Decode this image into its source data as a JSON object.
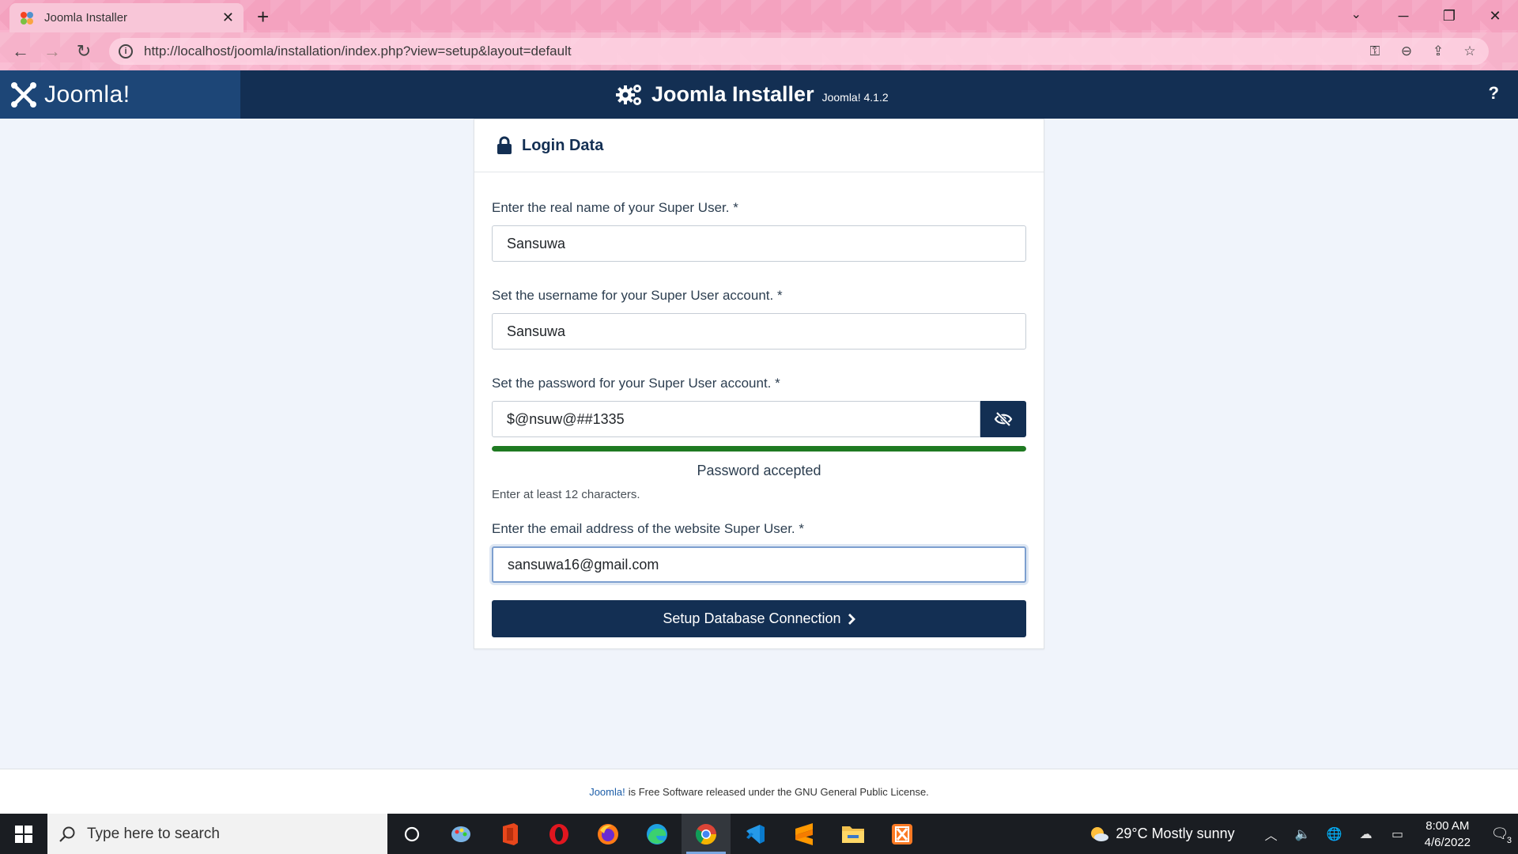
{
  "browser": {
    "tab_title": "Joomla Installer",
    "tab_close": "✕",
    "new_tab": "+",
    "url": "http://localhost/joomla/installation/index.php?view=setup&layout=default"
  },
  "header": {
    "logo_text": "Joomla!",
    "title": "Joomla Installer",
    "version": "Joomla! 4.1.2",
    "help": "?"
  },
  "card": {
    "title": "Login Data",
    "fields": {
      "realname": {
        "label": "Enter the real name of your Super User. *",
        "value": "Sansuwa"
      },
      "username": {
        "label": "Set the username for your Super User account. *",
        "value": "Sansuwa"
      },
      "password": {
        "label": "Set the password for your Super User account. *",
        "value": "$@nsuw@##1335",
        "strength_text": "Password accepted",
        "strength_fraction": 1.0,
        "hint": "Enter at least 12 characters."
      },
      "email": {
        "label": "Enter the email address of the website Super User. *",
        "value": "sansuwa16@gmail.com"
      }
    },
    "submit_label": "Setup Database Connection"
  },
  "footer": {
    "link": "Joomla!",
    "text": "is Free Software released under the GNU General Public License."
  },
  "taskbar": {
    "search_placeholder": "Type here to search",
    "weather": "29°C  Mostly sunny",
    "time": "8:00 AM",
    "date": "4/6/2022",
    "notifications": "3"
  },
  "colors": {
    "joomla_navy": "#132f53",
    "joomla_blue": "#1d4677",
    "meter_green": "#1f7a22",
    "browser_pink": "#f4a2bf"
  }
}
